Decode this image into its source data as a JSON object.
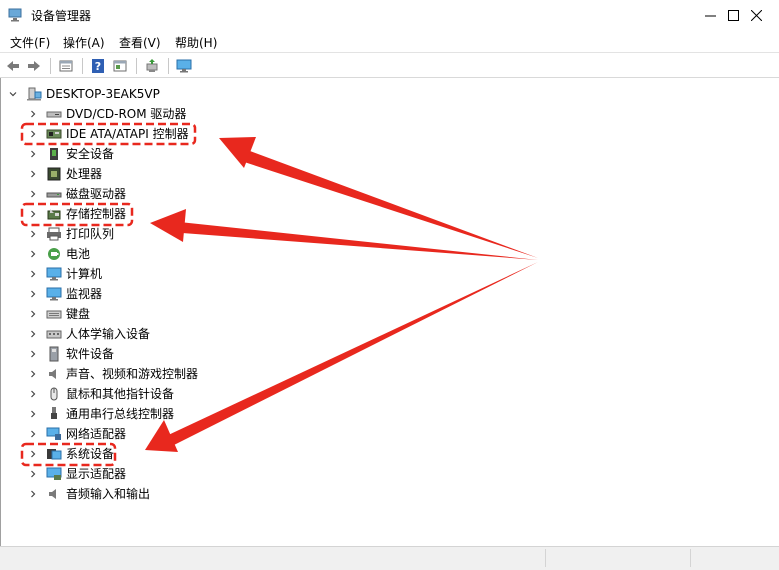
{
  "window": {
    "title": "设备管理器",
    "controls": [
      "minimize",
      "maximize",
      "close"
    ]
  },
  "menu": [
    {
      "label": "文件(F)"
    },
    {
      "label": "操作(A)"
    },
    {
      "label": "查看(V)"
    },
    {
      "label": "帮助(H)"
    }
  ],
  "toolbar": {
    "icons": [
      "back-arrow-icon",
      "forward-arrow-icon",
      "properties-icon",
      "help-icon",
      "view-icon",
      "update-driver-icon",
      "monitor-scan-icon"
    ]
  },
  "tree": {
    "root": "DESKTOP-3EAK5VP",
    "items": [
      {
        "label": "DVD/CD-ROM 驱动器",
        "icon": "dvd-drive-icon",
        "highlighted": false
      },
      {
        "label": "IDE ATA/ATAPI 控制器",
        "icon": "ide-controller-icon",
        "highlighted": true
      },
      {
        "label": "安全设备",
        "icon": "security-device-icon",
        "highlighted": false
      },
      {
        "label": "处理器",
        "icon": "processor-icon",
        "highlighted": false
      },
      {
        "label": "磁盘驱动器",
        "icon": "disk-drive-icon",
        "highlighted": false
      },
      {
        "label": "存储控制器",
        "icon": "storage-controller-icon",
        "highlighted": true
      },
      {
        "label": "打印队列",
        "icon": "printer-icon",
        "highlighted": false
      },
      {
        "label": "电池",
        "icon": "battery-icon",
        "highlighted": false
      },
      {
        "label": "计算机",
        "icon": "computer-icon",
        "highlighted": false
      },
      {
        "label": "监视器",
        "icon": "monitor-icon",
        "highlighted": false
      },
      {
        "label": "键盘",
        "icon": "keyboard-icon",
        "highlighted": false
      },
      {
        "label": "人体学输入设备",
        "icon": "hid-icon",
        "highlighted": false
      },
      {
        "label": "软件设备",
        "icon": "software-device-icon",
        "highlighted": false
      },
      {
        "label": "声音、视频和游戏控制器",
        "icon": "speaker-icon",
        "highlighted": false
      },
      {
        "label": "鼠标和其他指针设备",
        "icon": "mouse-icon",
        "highlighted": false
      },
      {
        "label": "通用串行总线控制器",
        "icon": "usb-icon",
        "highlighted": false
      },
      {
        "label": "网络适配器",
        "icon": "network-adapter-icon",
        "highlighted": false
      },
      {
        "label": "系统设备",
        "icon": "system-device-icon",
        "highlighted": true
      },
      {
        "label": "显示适配器",
        "icon": "display-adapter-icon",
        "highlighted": false
      },
      {
        "label": "音频输入和输出",
        "icon": "audio-io-icon",
        "highlighted": false
      }
    ]
  },
  "annotations": {
    "highlight_color": "#e8281e",
    "arrow_color": "#e8281e"
  }
}
